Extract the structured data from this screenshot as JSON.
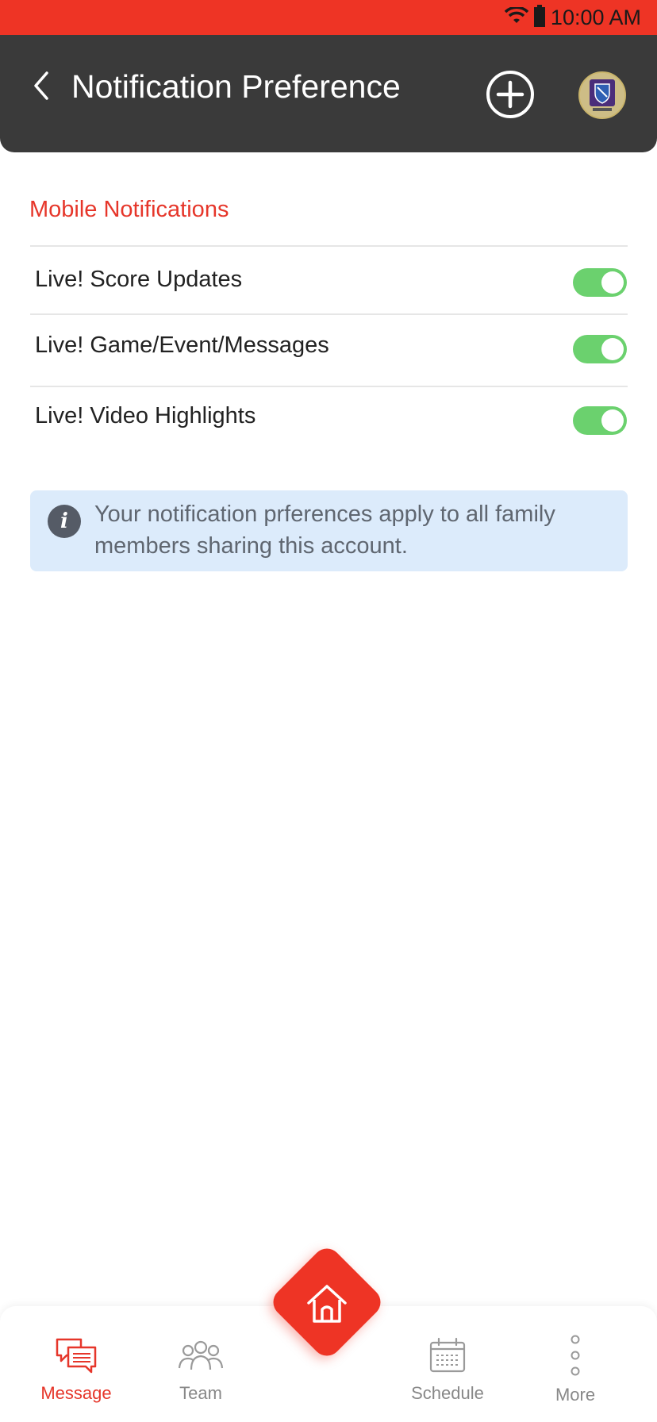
{
  "status_bar": {
    "time": "10:00 AM"
  },
  "header": {
    "title": "Notification Preference"
  },
  "section": {
    "title": "Mobile Notifications"
  },
  "preferences": [
    {
      "label": "Live! Score Updates",
      "enabled": true
    },
    {
      "label": "Live! Game/Event/Messages",
      "enabled": true
    },
    {
      "label": "Live! Video Highlights",
      "enabled": true
    }
  ],
  "info": {
    "text": "Your notification prferences apply to all family members sharing this account."
  },
  "bottom_nav": {
    "items": [
      {
        "label": "Message",
        "active": true
      },
      {
        "label": "Team",
        "active": false
      },
      {
        "label": "Schedule",
        "active": false
      },
      {
        "label": "More",
        "active": false
      }
    ]
  },
  "colors": {
    "brand_red": "#ee3425",
    "header_bg": "#3a3a3a",
    "toggle_on": "#6bd16e",
    "info_bg": "#dcebfb"
  }
}
